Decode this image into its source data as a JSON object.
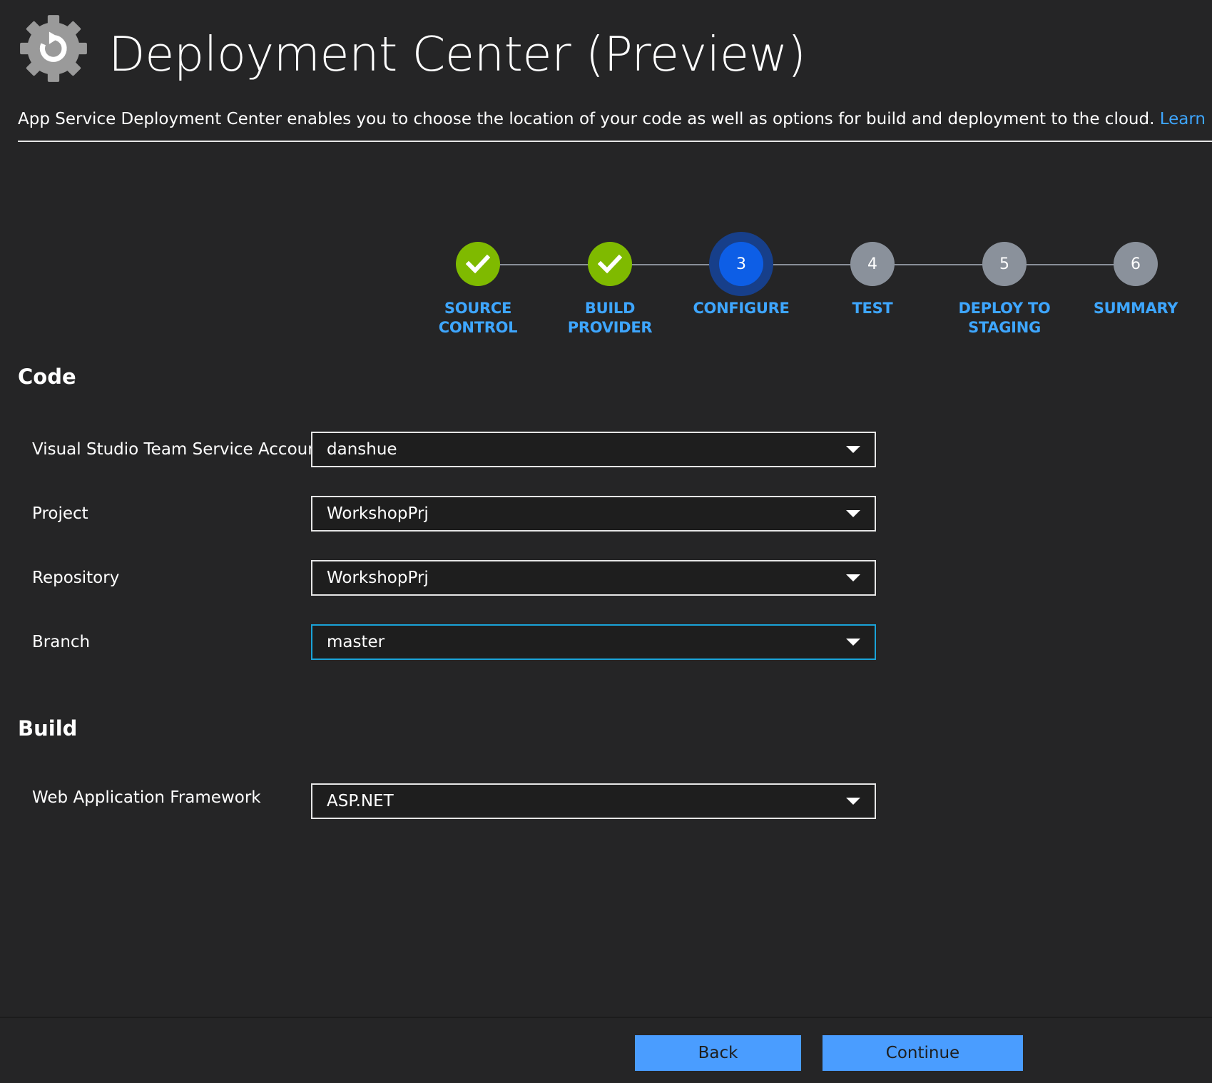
{
  "header": {
    "title": "Deployment Center (Preview)",
    "description": "App Service Deployment Center enables you to choose the location of your code as well as options for build and deployment to the cloud.",
    "learn_more": "Learn more",
    "icon": "gear-refresh-icon"
  },
  "stepper": {
    "steps": [
      {
        "label": "SOURCE\nCONTROL",
        "number": "1",
        "state": "done"
      },
      {
        "label": "BUILD PROVIDER",
        "number": "2",
        "state": "done"
      },
      {
        "label": "CONFIGURE",
        "number": "3",
        "state": "current"
      },
      {
        "label": "TEST",
        "number": "4",
        "state": "todo"
      },
      {
        "label": "DEPLOY TO\nSTAGING",
        "number": "5",
        "state": "todo"
      },
      {
        "label": "SUMMARY",
        "number": "6",
        "state": "todo"
      }
    ]
  },
  "code": {
    "heading": "Code",
    "fields": [
      {
        "label": "Visual Studio Team Service Account",
        "value": "danshue"
      },
      {
        "label": "Project",
        "value": "WorkshopPrj"
      },
      {
        "label": "Repository",
        "value": "WorkshopPrj"
      },
      {
        "label": "Branch",
        "value": "master"
      }
    ]
  },
  "build": {
    "heading": "Build",
    "fields": [
      {
        "label": "Web Application Framework",
        "value": "ASP.NET"
      }
    ]
  },
  "footer": {
    "back_label": "Back",
    "continue_label": "Continue"
  },
  "colors": {
    "background": "#252526",
    "accent": "#3ea6ff",
    "done": "#7fba00",
    "current": "#0d5ee6",
    "todo": "#8a919b",
    "button": "#4a9dff"
  }
}
